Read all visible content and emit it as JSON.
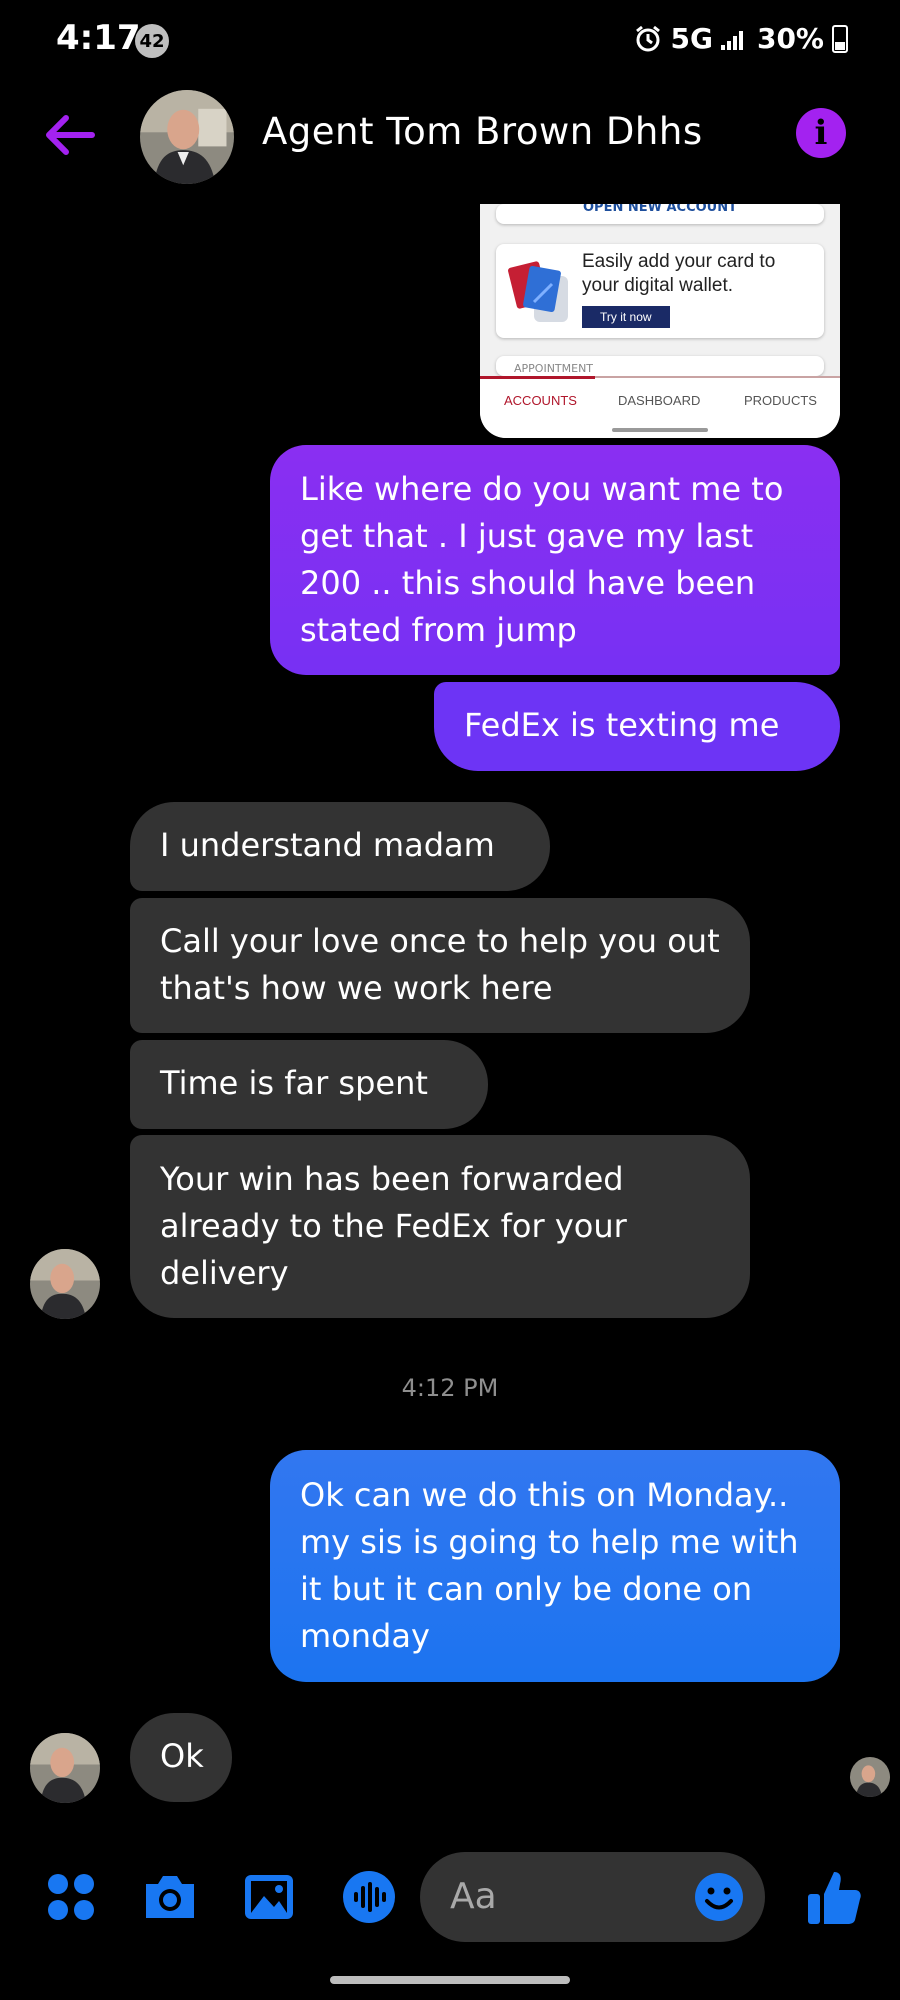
{
  "status_bar": {
    "time": "4:17",
    "notification_count": "42",
    "network": "5G",
    "battery": "30%"
  },
  "header": {
    "contact_name": "Agent Tom Brown Dhhs"
  },
  "shared_image": {
    "top_card_text": "OPEN NEW ACCOUNT",
    "wallet_text": "Easily add your card to your digital wallet.",
    "try_button": "Try it now",
    "faded_card_text": "APPOINTMENT",
    "tabs": [
      "ACCOUNTS",
      "DASHBOARD",
      "PRODUCTS"
    ]
  },
  "messages": {
    "m1": "Like where do you want me to get that . I just gave my last 200 .. this should have been stated from jump",
    "m2": "FedEx is texting me",
    "m3": "I understand madam",
    "m4": "Call your love once to help you out that's how we work here",
    "m5": "Time is far spent",
    "m6": "Your win has been forwarded already to the FedEx for your delivery",
    "timestamp": "4:12 PM",
    "m7": "Ok can we do this on Monday.. my sis is going to help me with it but it can only be done on monday",
    "m8": "Ok"
  },
  "composer": {
    "placeholder": "Aa"
  },
  "colors": {
    "accent": "#a322f0",
    "sent_purple": "#7431f5",
    "sent_blue": "#1c74f0",
    "received": "#333333",
    "icon_blue": "#1877f2"
  },
  "icons": [
    "back-arrow-icon",
    "info-icon",
    "menu-dots-icon",
    "camera-icon",
    "gallery-icon",
    "voice-icon",
    "emoji-icon",
    "thumbs-up-icon"
  ]
}
